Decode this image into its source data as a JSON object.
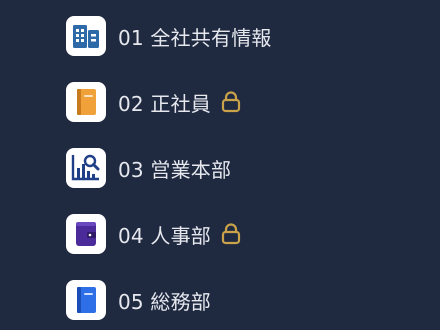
{
  "nav": {
    "items": [
      {
        "label": "01 全社共有情報",
        "icon": "building-icon",
        "locked": false
      },
      {
        "label": "02 正社員",
        "icon": "orange-notebook-icon",
        "locked": true
      },
      {
        "label": "03 営業本部",
        "icon": "chart-search-icon",
        "locked": false
      },
      {
        "label": "04 人事部",
        "icon": "purple-wallet-icon",
        "locked": true
      },
      {
        "label": "05 総務部",
        "icon": "blue-notebook-icon",
        "locked": false
      }
    ]
  },
  "colors": {
    "background": "#1f2940",
    "text": "#e6e8ee",
    "lock": "#c9a24a",
    "icon_tile": "#ffffff",
    "building": "#2f6aa8",
    "orange_notebook": "#f0a13a",
    "chart": "#1f3f87",
    "purple_wallet": "#4b2a9a",
    "blue_notebook": "#2e6fe8"
  }
}
